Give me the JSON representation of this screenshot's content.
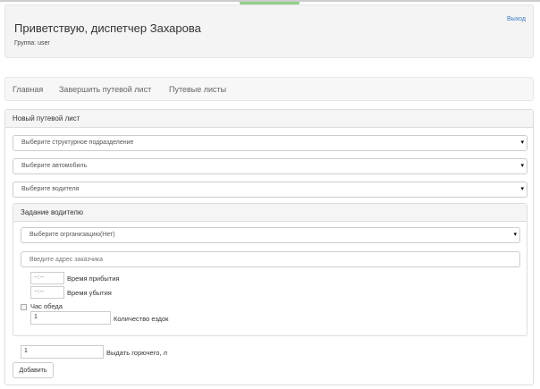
{
  "header": {
    "title": "Приветствую, диспетчер Захарова",
    "group": "Группа: user",
    "logout": "Выход"
  },
  "nav": [
    "Главная",
    "Завершить путевой лист",
    "Путевые листы"
  ],
  "form": {
    "title": "Новый путевой лист",
    "selects": [
      "Выберите структурное подразделение",
      "Выберите автомобиль",
      "Выберите водителя"
    ],
    "task": {
      "title": "Задание водителю",
      "org_select": "Выберите огрганизацию(Нет)",
      "address_placeholder": "Введите адрес заказчика",
      "arrival_value": "--:--",
      "arrival_label": "Время прибытия",
      "departure_value": "--:--",
      "departure_label": "Время убытия",
      "lunch_label": "Час обеда",
      "lunch_checked": false,
      "trips_value": "1",
      "trips_label": "Количество ездок"
    },
    "fuel_value": "1",
    "fuel_label": "Выдать горючего, л",
    "add_button": "Добавить"
  }
}
